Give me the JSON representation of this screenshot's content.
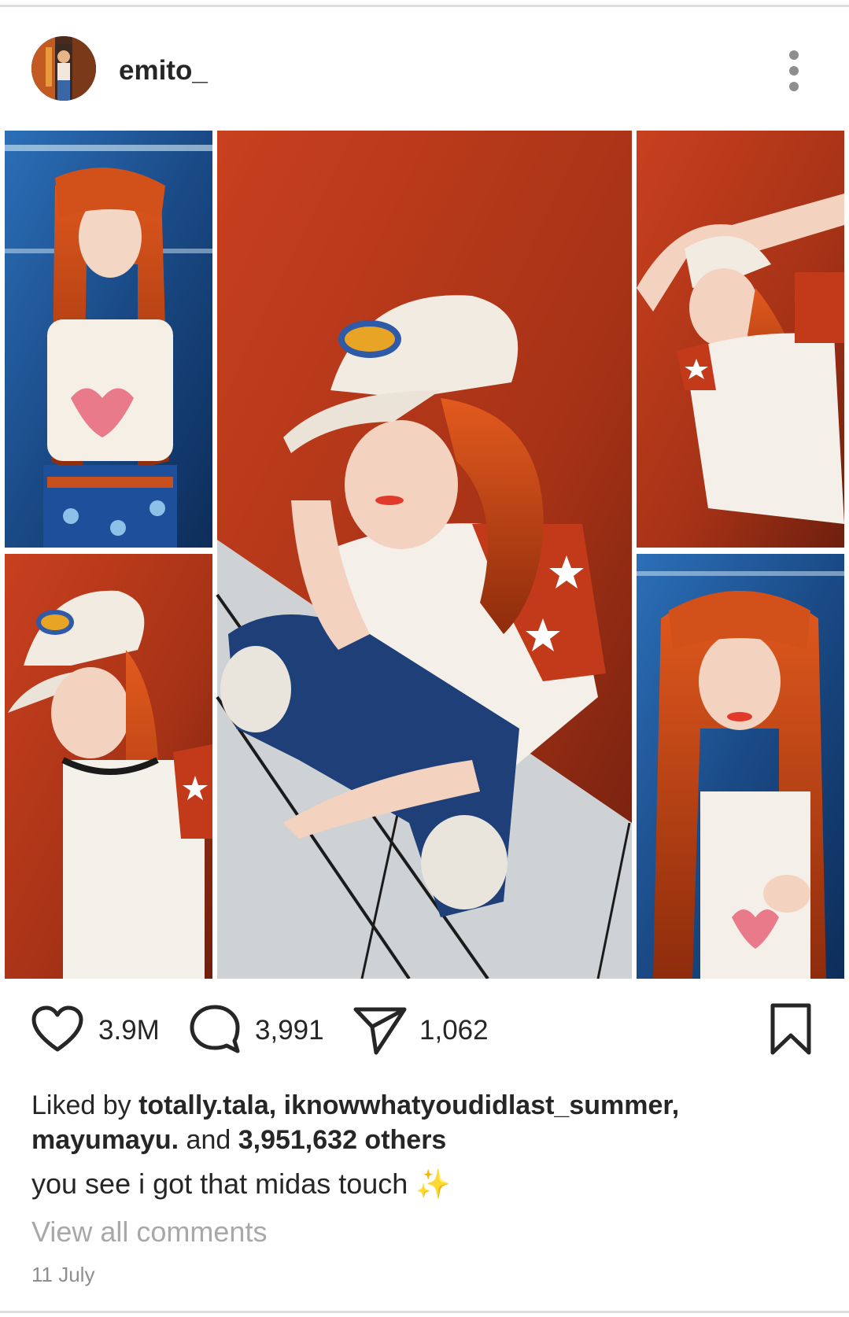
{
  "post": {
    "username": "emito_",
    "likes_count": "3.9M",
    "comments_count": "3,991",
    "shares_count": "1,062",
    "liked_by_prefix": "Liked by ",
    "liked_by_users": "totally.tala, iknowwhatyoudidlast_summer, mayumayu.",
    "liked_by_and": " and ",
    "liked_by_others": "3,951,632 others",
    "caption": "you see i got that midas touch ✨",
    "view_all_comments": "View all comments",
    "date": "11 July"
  },
  "icons": {
    "like": "heart-icon",
    "comment": "comment-bubble-icon",
    "share": "paper-plane-icon",
    "save": "bookmark-icon",
    "more": "more-options-icon"
  },
  "colors": {
    "text": "#262626",
    "muted": "#a8a8a8",
    "date": "#8e8e8e",
    "photo_wall": "#b8381c",
    "photo_blue": "#1f5b9e"
  }
}
